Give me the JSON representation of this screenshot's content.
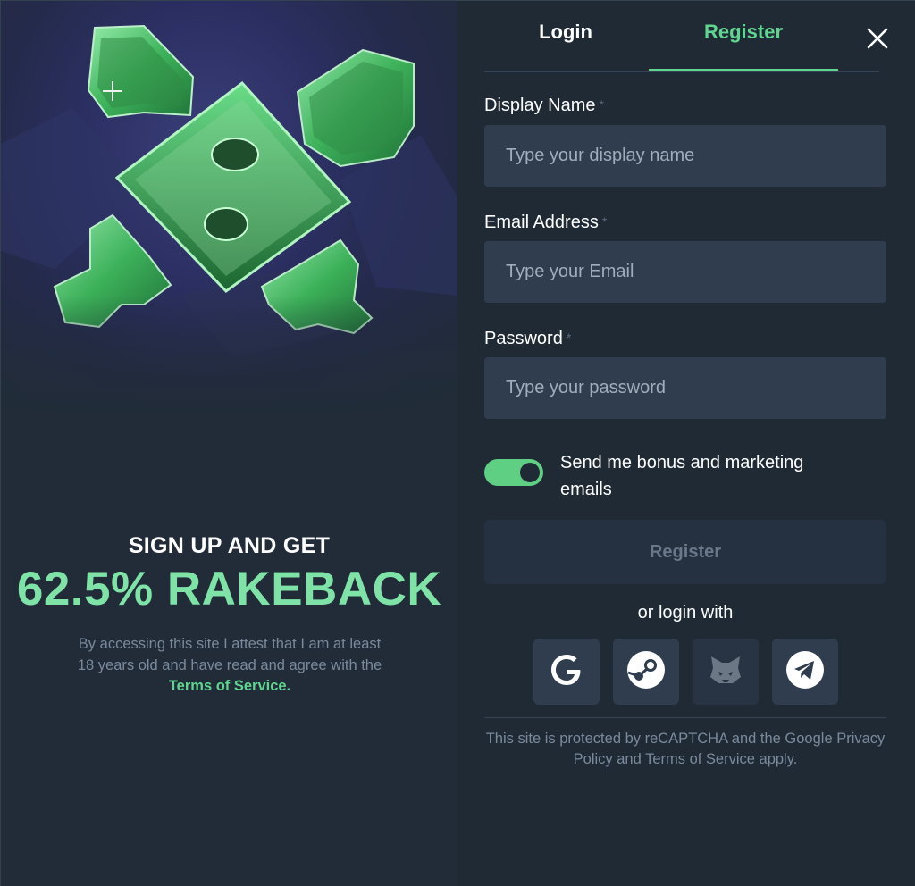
{
  "promo": {
    "headline": "SIGN UP AND GET",
    "offer": "62.5% RAKEBACK",
    "disclaimer_prefix": "By accessing this site I attest that I am at least 18 years old and have read and agree with the ",
    "terms_link": "Terms of Service."
  },
  "tabs": {
    "login": "Login",
    "register": "Register",
    "active": "register"
  },
  "form": {
    "display_name": {
      "label": "Display Name",
      "required_mark": "*",
      "placeholder": "Type your display name",
      "value": ""
    },
    "email": {
      "label": "Email Address",
      "required_mark": "*",
      "placeholder": "Type your Email",
      "value": ""
    },
    "password": {
      "label": "Password",
      "required_mark": "*",
      "placeholder": "Type your password",
      "value": ""
    },
    "marketing_toggle": {
      "label": "Send me bonus and marketing emails",
      "checked": true
    },
    "submit_label": "Register"
  },
  "social": {
    "heading": "or login with",
    "providers": [
      {
        "name": "google",
        "icon": "google-icon"
      },
      {
        "name": "steam",
        "icon": "steam-icon"
      },
      {
        "name": "metamask",
        "icon": "metamask-icon"
      },
      {
        "name": "telegram",
        "icon": "telegram-icon"
      }
    ]
  },
  "recaptcha_notice": "This site is protected by reCAPTCHA and the Google Privacy Policy and Terms of Service apply.",
  "colors": {
    "accent_green": "#5fd58f",
    "promo_green": "#7fe3a8",
    "panel_bg": "#1f2a35",
    "input_bg": "#2f3d4e"
  }
}
